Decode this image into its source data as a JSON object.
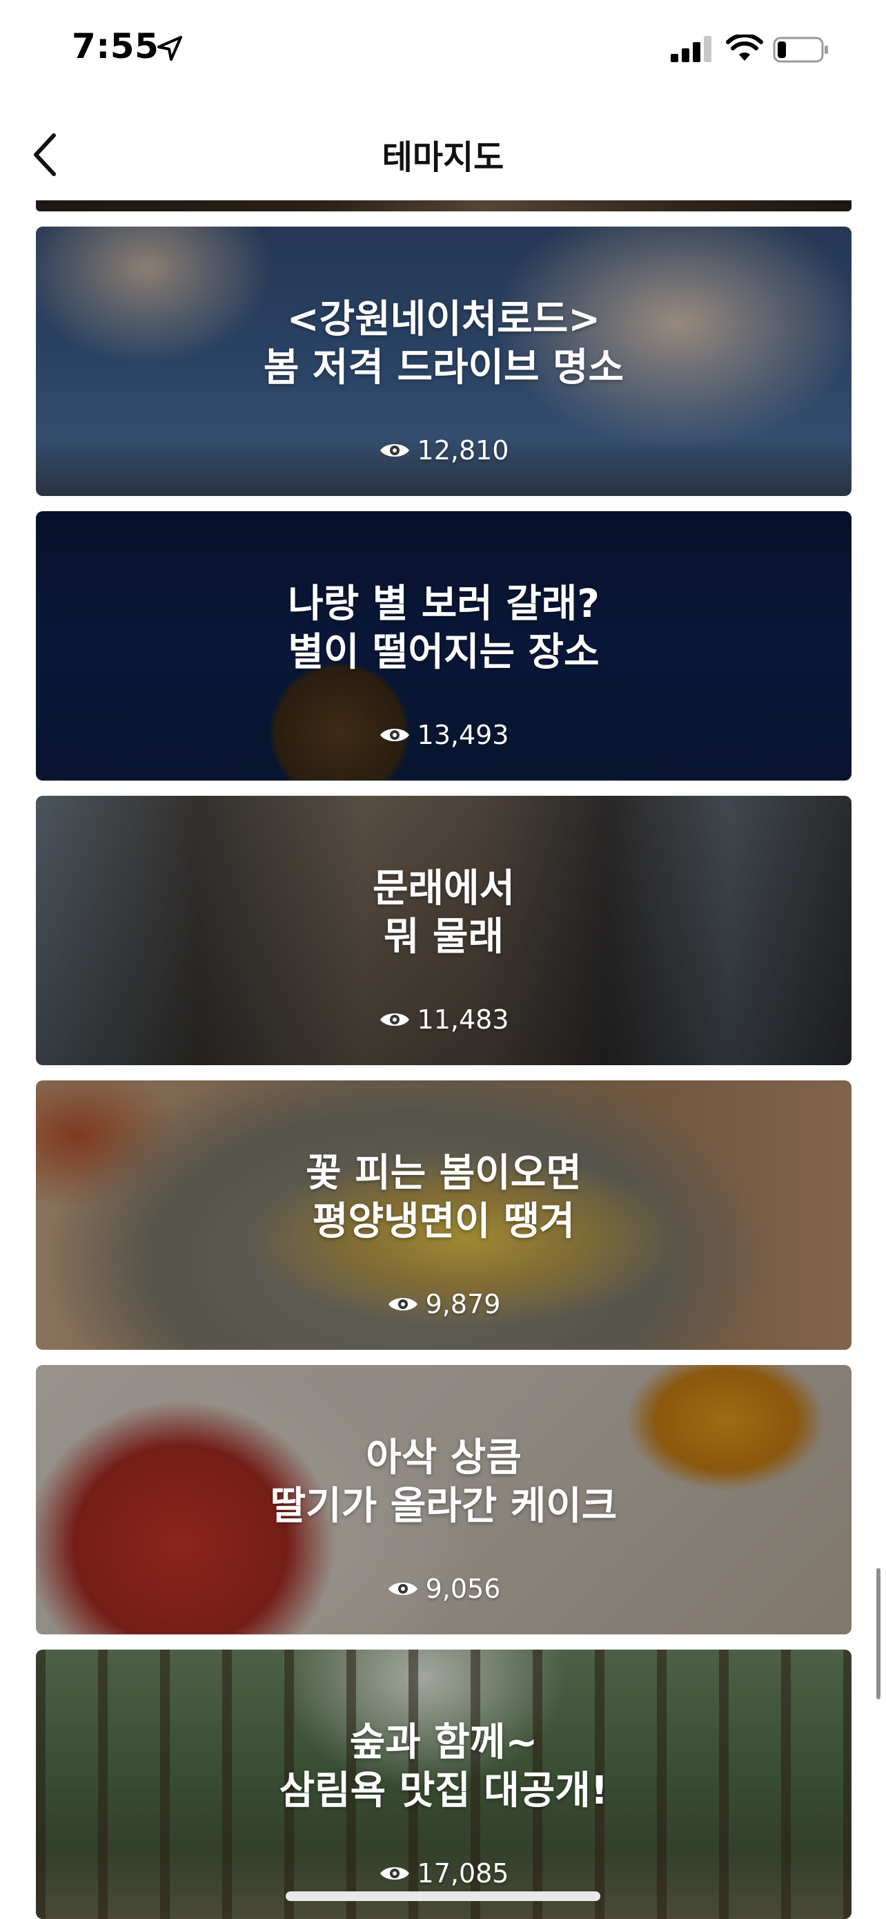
{
  "status_bar": {
    "time": "7:55"
  },
  "nav": {
    "title": "테마지도"
  },
  "cards": [
    {
      "title_line1": "<강원네이처로드>",
      "title_line2": "봄 저격 드라이브 명소",
      "views": "12,810"
    },
    {
      "title_line1": "나랑 별 보러 갈래?",
      "title_line2": "별이 떨어지는 장소",
      "views": "13,493"
    },
    {
      "title_line1": "문래에서",
      "title_line2": "뭐 물래",
      "views": "11,483"
    },
    {
      "title_line1": "꽃 피는 봄이오면",
      "title_line2": "평양냉면이 땡겨",
      "views": "9,879"
    },
    {
      "title_line1": "아삭 상큼",
      "title_line2": "딸기가 올라간 케이크",
      "views": "9,056"
    },
    {
      "title_line1": "숲과 함께~",
      "title_line2": "삼림욕 맛집 대공개!",
      "views": "17,085"
    }
  ],
  "icons": {
    "back": "chevron-left-icon",
    "views": "eye-icon",
    "location": "location-arrow-icon",
    "signal": "cellular-signal-icon",
    "wifi": "wifi-icon",
    "battery": "battery-icon"
  }
}
